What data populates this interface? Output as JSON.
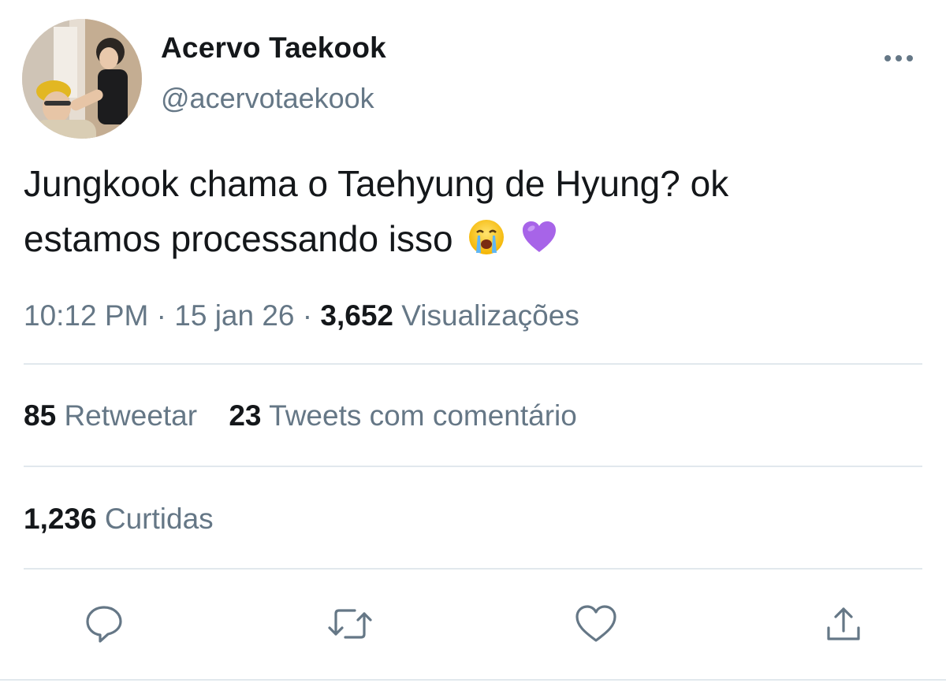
{
  "user": {
    "display_name": "Acervo Taekook",
    "handle": "@acervotaekook",
    "avatar_icon": "profile-photo"
  },
  "more_icon": "more-options-icon",
  "tweet": {
    "text_line1": "Jungkook chama o Taehyung de Hyung? ok",
    "text_line2": "estamos processando isso",
    "emojis": [
      "loudly-crying-face",
      "purple-heart"
    ]
  },
  "meta": {
    "time": "10:12 PM",
    "separator": "·",
    "date": "15 jan 26",
    "views_count": "3,652",
    "views_label": "Visualizações"
  },
  "stats": {
    "retweets_count": "85",
    "retweets_label": "Retweetar",
    "quotes_count": "23",
    "quotes_label": "Tweets com comentário",
    "likes_count": "1,236",
    "likes_label": "Curtidas"
  },
  "actions": [
    "reply-icon",
    "retweet-icon",
    "like-icon",
    "share-icon"
  ],
  "colors": {
    "text": "#14171a",
    "muted": "#657786",
    "divider": "#e1e8ed",
    "heart_purple": "#a764e8"
  }
}
